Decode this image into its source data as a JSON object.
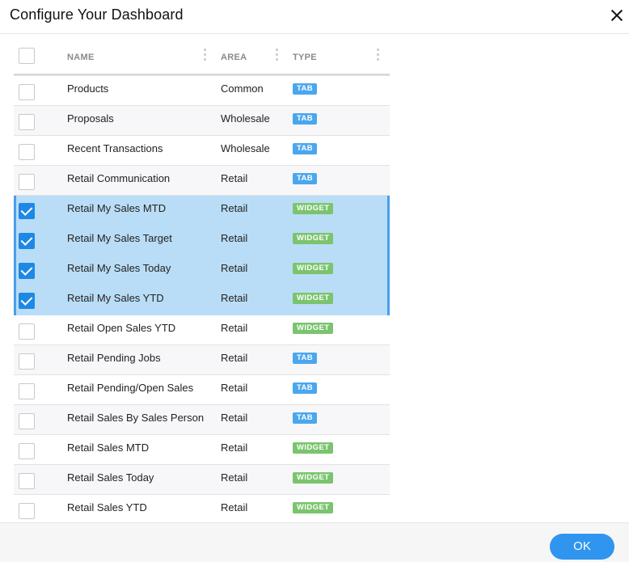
{
  "dialog": {
    "title": "Configure Your Dashboard",
    "ok_label": "OK"
  },
  "table": {
    "columns": [
      "NAME",
      "AREA",
      "TYPE"
    ],
    "rows": [
      {
        "name": "Products",
        "area": "Common",
        "type": "TAB",
        "checked": false
      },
      {
        "name": "Proposals",
        "area": "Wholesale",
        "type": "TAB",
        "checked": false
      },
      {
        "name": "Recent Transactions",
        "area": "Wholesale",
        "type": "TAB",
        "checked": false
      },
      {
        "name": "Retail Communication",
        "area": "Retail",
        "type": "TAB",
        "checked": false
      },
      {
        "name": "Retail My Sales MTD",
        "area": "Retail",
        "type": "WIDGET",
        "checked": true
      },
      {
        "name": "Retail My Sales Target",
        "area": "Retail",
        "type": "WIDGET",
        "checked": true
      },
      {
        "name": "Retail My Sales Today",
        "area": "Retail",
        "type": "WIDGET",
        "checked": true
      },
      {
        "name": "Retail My Sales YTD",
        "area": "Retail",
        "type": "WIDGET",
        "checked": true
      },
      {
        "name": "Retail Open Sales YTD",
        "area": "Retail",
        "type": "WIDGET",
        "checked": false
      },
      {
        "name": "Retail Pending Jobs",
        "area": "Retail",
        "type": "TAB",
        "checked": false
      },
      {
        "name": "Retail Pending/Open Sales",
        "area": "Retail",
        "type": "TAB",
        "checked": false
      },
      {
        "name": "Retail Sales By Sales Person",
        "area": "Retail",
        "type": "TAB",
        "checked": false
      },
      {
        "name": "Retail Sales MTD",
        "area": "Retail",
        "type": "WIDGET",
        "checked": false
      },
      {
        "name": "Retail Sales Today",
        "area": "Retail",
        "type": "WIDGET",
        "checked": false
      },
      {
        "name": "Retail Sales YTD",
        "area": "Retail",
        "type": "WIDGET",
        "checked": false
      }
    ]
  },
  "colors": {
    "selected_row": "#b9ddf6",
    "checkbox_checked": "#1e88e5",
    "badge_tab": "#4aa7ee",
    "badge_widget": "#7bc46e",
    "ok_button": "#2f95ee"
  },
  "icons": {
    "close": "close-icon",
    "column_menu": "kebab-icon"
  }
}
